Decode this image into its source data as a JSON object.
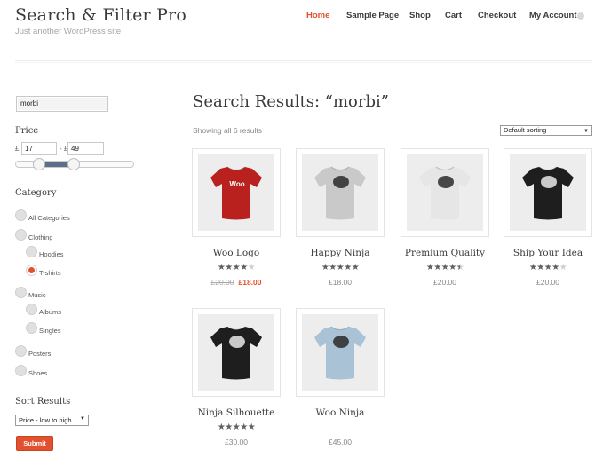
{
  "site": {
    "title": "Search & Filter Pro",
    "description": "Just another WordPress site"
  },
  "nav": {
    "items": [
      {
        "label": "Home",
        "active": true
      },
      {
        "label": "Sample Page",
        "active": false
      },
      {
        "label": "Shop",
        "active": false
      },
      {
        "label": "Cart",
        "active": false
      },
      {
        "label": "Checkout",
        "active": false
      },
      {
        "label": "My Account",
        "active": false
      }
    ]
  },
  "sidebar": {
    "search_value": "morbi",
    "price": {
      "title": "Price",
      "currency": "£",
      "separator": "-",
      "min": "17",
      "max": "49"
    },
    "category": {
      "title": "Category",
      "items": [
        {
          "label": "All Categories",
          "checked": false
        },
        {
          "label": "Clothing",
          "checked": false
        },
        {
          "label": "Hoodies",
          "checked": false
        },
        {
          "label": "T-shirts",
          "checked": true
        },
        {
          "label": "Music",
          "checked": false
        },
        {
          "label": "Albums",
          "checked": false
        },
        {
          "label": "Singles",
          "checked": false
        },
        {
          "label": "Posters",
          "checked": false
        },
        {
          "label": "Shoes",
          "checked": false
        }
      ]
    },
    "sort": {
      "title": "Sort Results",
      "selected": "Price - low to high"
    },
    "submit_label": "Submit"
  },
  "main": {
    "title": "Search Results: “morbi”",
    "result_count": "Showing all 6 results",
    "orderby_selected": "Default sorting",
    "products": [
      {
        "name": "Woo Logo",
        "rating": 4,
        "old_price": "£20.00",
        "price": "£18.00",
        "shirt_color": "#b8211d",
        "print": "Woo"
      },
      {
        "name": "Happy Ninja",
        "rating": 5,
        "old_price": "",
        "price": "£18.00",
        "shirt_color": "#c9c9c9",
        "print": ""
      },
      {
        "name": "Premium Quality",
        "rating": 4.5,
        "old_price": "",
        "price": "£20.00",
        "shirt_color": "#e6e6e6",
        "print": ""
      },
      {
        "name": "Ship Your Idea",
        "rating": 4,
        "old_price": "",
        "price": "£20.00",
        "shirt_color": "#1e1e1e",
        "print": ""
      },
      {
        "name": "Ninja Silhouette",
        "rating": 5,
        "old_price": "",
        "price": "£30.00",
        "shirt_color": "#1e1e1e",
        "print": ""
      },
      {
        "name": "Woo Ninja",
        "rating": 0,
        "old_price": "",
        "price": "£45.00",
        "shirt_color": "#a9c2d6",
        "print": ""
      }
    ]
  },
  "colors": {
    "accent": "#e2512f",
    "text": "#3a3a3a"
  }
}
